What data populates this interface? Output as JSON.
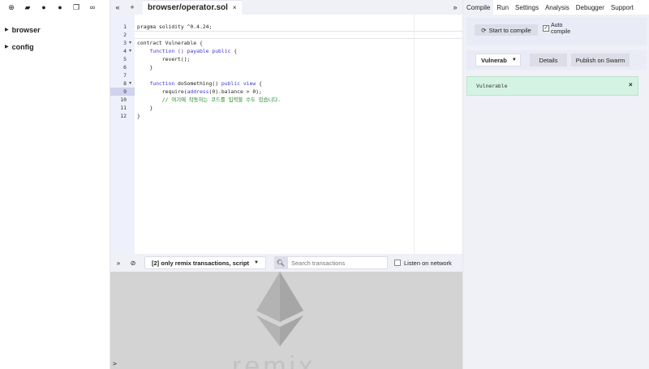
{
  "left_panel": {
    "toolbar_icons": [
      "plus-icon",
      "folder-icon",
      "github-icon",
      "github-icon",
      "copy-icon",
      "link-icon"
    ],
    "tree": [
      {
        "label": "browser"
      },
      {
        "label": "config"
      }
    ]
  },
  "editor": {
    "tab_nav_left": "«",
    "tab_nav_plus": "+",
    "tab_name": "browser/operator.sol",
    "tab_close": "×",
    "tab_nav_right": "»",
    "active_line": 9,
    "lines": [
      {
        "n": "1",
        "fold": "",
        "parts": [
          [
            "",
            "pragma solidity ^0.4.24;"
          ]
        ]
      },
      {
        "n": "2",
        "fold": "",
        "parts": [
          [
            "",
            ""
          ]
        ]
      },
      {
        "n": "3",
        "fold": "▾",
        "parts": [
          [
            "",
            "contract Vulnerable {"
          ]
        ]
      },
      {
        "n": "4",
        "fold": "▾",
        "parts": [
          [
            "",
            "    "
          ],
          [
            "kw",
            "function () payable public"
          ],
          [
            "",
            " {"
          ]
        ]
      },
      {
        "n": "5",
        "fold": "",
        "parts": [
          [
            "",
            "        revert();"
          ]
        ]
      },
      {
        "n": "6",
        "fold": "",
        "parts": [
          [
            "",
            "    }"
          ]
        ]
      },
      {
        "n": "7",
        "fold": "",
        "parts": [
          [
            "",
            ""
          ]
        ]
      },
      {
        "n": "8",
        "fold": "▾",
        "parts": [
          [
            "",
            "    "
          ],
          [
            "kw",
            "function"
          ],
          [
            "",
            " doSomething() "
          ],
          [
            "kw",
            "public view"
          ],
          [
            "",
            " {"
          ]
        ]
      },
      {
        "n": "9",
        "fold": "",
        "parts": [
          [
            "",
            "        require("
          ],
          [
            "kw",
            "address"
          ],
          [
            "",
            "(0).balance > 0);"
          ]
        ]
      },
      {
        "n": "10",
        "fold": "",
        "parts": [
          [
            "cm",
            "        // 여기에 작동하는 코드를 입력할 수도 있습니다."
          ]
        ]
      },
      {
        "n": "11",
        "fold": "",
        "parts": [
          [
            "",
            "    }"
          ]
        ]
      },
      {
        "n": "12",
        "fold": "",
        "parts": [
          [
            "",
            "}"
          ]
        ]
      }
    ]
  },
  "terminal_bar": {
    "collapse_icon": "»",
    "clear_icon": "⊘",
    "filter_label": "[2] only remix transactions, script",
    "search_placeholder": "Search transactions",
    "listen_label": "Listen on network"
  },
  "terminal": {
    "prompt": ">",
    "watermark": "remix"
  },
  "right_panel": {
    "tabs": [
      "Compile",
      "Run",
      "Settings",
      "Analysis",
      "Debugger",
      "Support"
    ],
    "active_tab": "Compile",
    "compile_button": "Start to compile",
    "auto_compile_checked": true,
    "auto_compile_label": "Auto compile",
    "contract_selected": "Vulnerab",
    "details_button": "Details",
    "publish_button": "Publish on Swarm",
    "result_text": "Vulnerable",
    "result_close": "×",
    "colors": {
      "result_bg": "#d5f3e3",
      "panel_bg": "#f0f0f7"
    }
  }
}
